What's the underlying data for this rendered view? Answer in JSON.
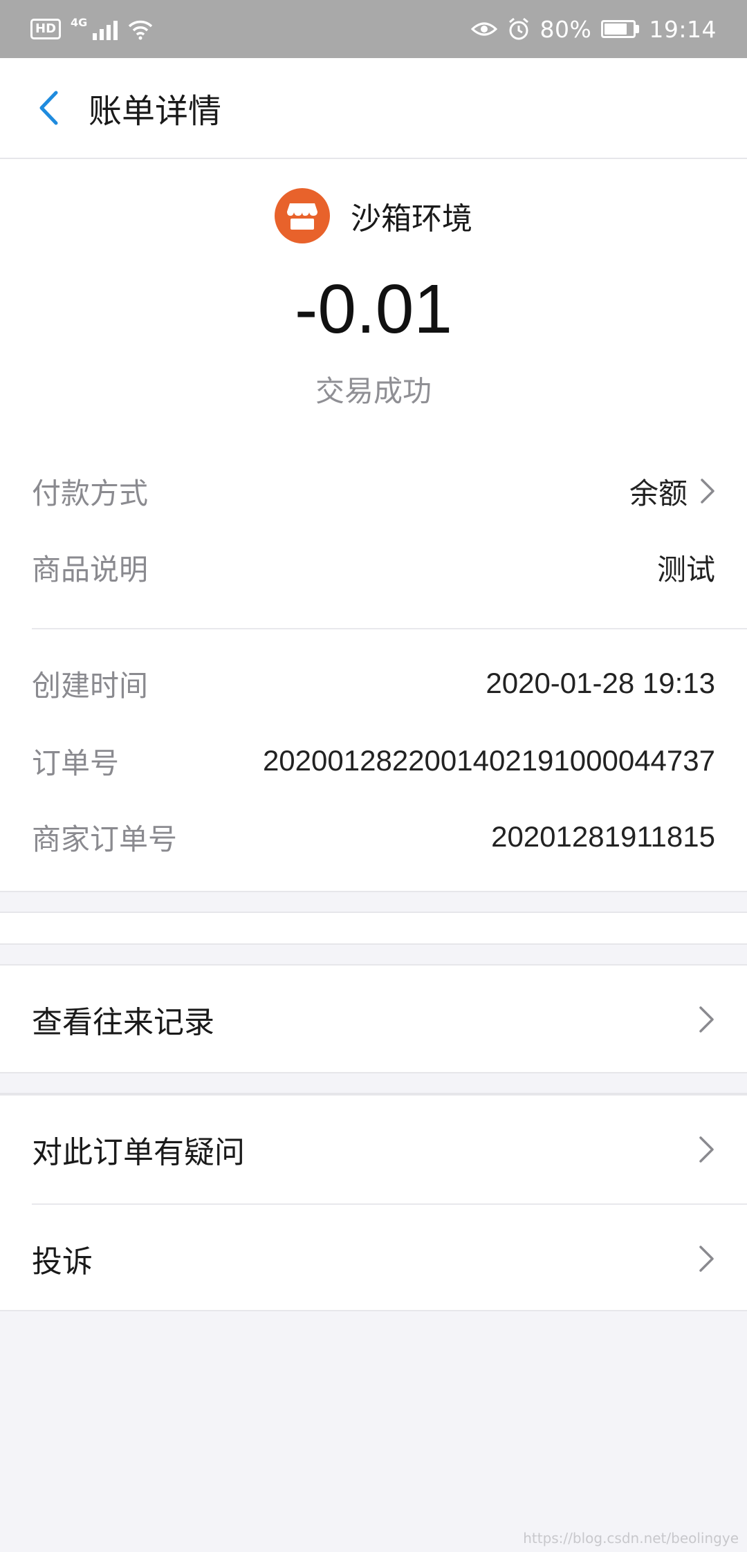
{
  "status_bar": {
    "hd": "HD",
    "network": "4G",
    "battery_text": "80%",
    "battery_level": 0.8,
    "time": "19:14",
    "icons": [
      "hd-icon",
      "signal-icon",
      "wifi-icon",
      "eye-icon",
      "alarm-icon",
      "battery-icon"
    ]
  },
  "header": {
    "back_icon": "chevron-left-icon",
    "title": "账单详情"
  },
  "colors": {
    "accent": "#1f8bde",
    "merchant_icon_bg": "#e8622b",
    "status_bar_bg": "#a9a9a9"
  },
  "summary": {
    "merchant_icon": "shop-icon",
    "merchant_name": "沙箱环境",
    "amount": "-0.01",
    "status": "交易成功"
  },
  "details": {
    "payment_method": {
      "label": "付款方式",
      "value": "余额"
    },
    "product_desc": {
      "label": "商品说明",
      "value": "测试"
    },
    "created_time": {
      "label": "创建时间",
      "value": "2020-01-28 19:13"
    },
    "order_no": {
      "label": "订单号",
      "value": "2020012822001402191000044737"
    },
    "merchant_order_no": {
      "label": "商家订单号",
      "value": "20201281911815"
    }
  },
  "menu": {
    "history": "查看往来记录",
    "question": "对此订单有疑问",
    "complaint": "投诉"
  },
  "watermark": "https://blog.csdn.net/beolingye"
}
